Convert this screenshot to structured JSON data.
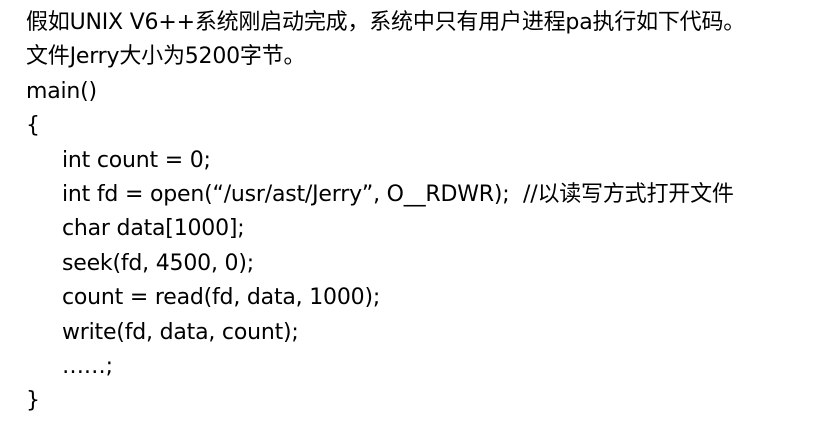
{
  "intro": {
    "line1": "假如UNIX V6++系统刚启动完成，系统中只有用户进程pa执行如下代码。",
    "line2": "文件Jerry大小为5200字节。"
  },
  "code": {
    "signature": "main()",
    "open_brace": "{",
    "body": [
      "int count = 0;",
      "int fd = open(“/usr/ast/Jerry”, O__RDWR);  //以读写方式打开文件",
      "char data[1000];",
      "seek(fd, 4500, 0);",
      "count = read(fd, data, 1000);",
      "write(fd, data, count);",
      "……;"
    ],
    "close_brace": "}"
  }
}
